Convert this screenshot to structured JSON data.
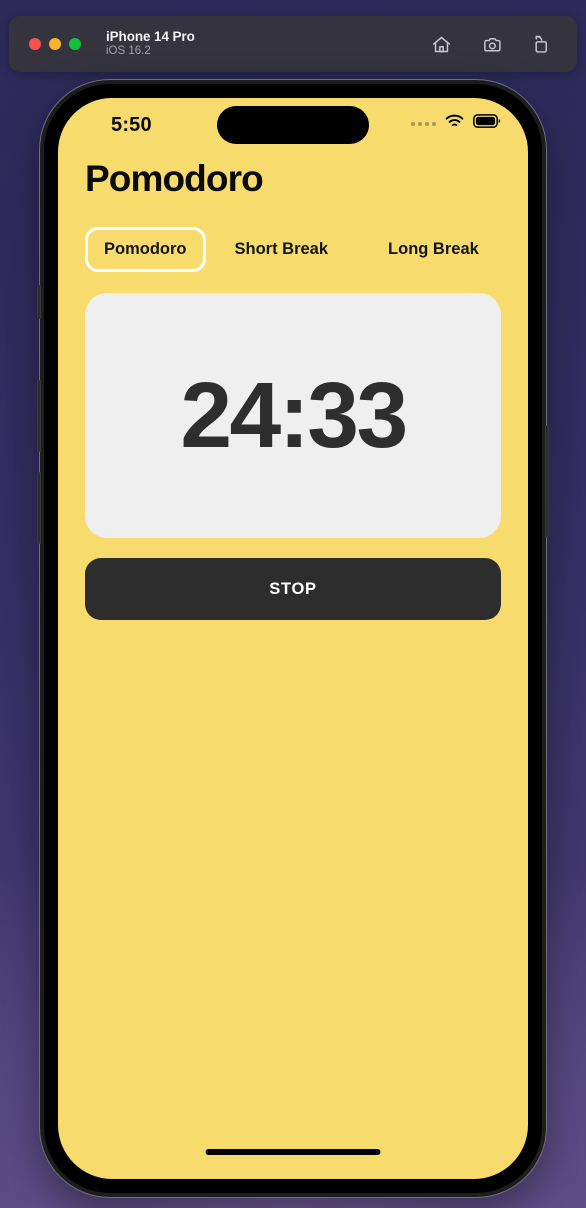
{
  "simulator": {
    "window_title": "iPhone 14 Pro",
    "window_subtitle": "iOS 16.2",
    "traffic_lights": [
      {
        "name": "close",
        "color": "#f9534f"
      },
      {
        "name": "minimize",
        "color": "#f9b42d"
      },
      {
        "name": "zoom",
        "color": "#14c13b"
      }
    ],
    "actions": [
      {
        "name": "home-icon",
        "label": "Home"
      },
      {
        "name": "screenshot-camera-icon",
        "label": "Screenshot"
      },
      {
        "name": "rotate-icon",
        "label": "Rotate"
      }
    ]
  },
  "status_bar": {
    "time": "5:50",
    "cellular_dots": 4,
    "wifi": "wifi-icon",
    "battery": "battery-icon"
  },
  "app": {
    "title": "Pomodoro",
    "tabs": [
      {
        "label": "Pomodoro",
        "active": true
      },
      {
        "label": "Short Break",
        "active": false
      },
      {
        "label": "Long Break",
        "active": false
      }
    ],
    "timer": {
      "value": "24:33"
    },
    "action_button": {
      "label": "STOP"
    }
  },
  "colors": {
    "app_background": "#f7db6d",
    "timer_card": "#efeff0",
    "timer_text": "#2e2e2e",
    "action_button": "#2e2d2d",
    "action_button_text": "#ffffff",
    "active_tab_border": "#ffffff",
    "desktop_background": "#2f2a5c",
    "window_bar": "#35343e"
  }
}
